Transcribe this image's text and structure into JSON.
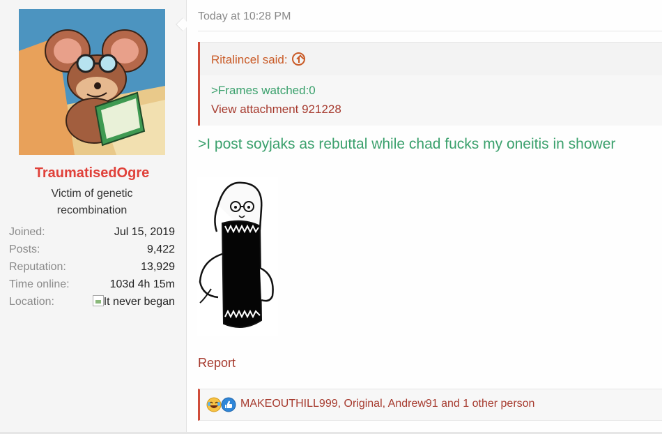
{
  "user": {
    "username": "TraumatisedOgre",
    "title": "Victim of genetic recombination",
    "avatar_icon": "cartoon-mouse-reading-avatar",
    "stats": [
      {
        "label": "Joined:",
        "value": "Jul 15, 2019"
      },
      {
        "label": "Posts:",
        "value": "9,422"
      },
      {
        "label": "Reputation:",
        "value": "13,929"
      },
      {
        "label": "Time online:",
        "value": "103d 4h 15m"
      },
      {
        "label": "Location:",
        "value": "It never began"
      }
    ]
  },
  "post": {
    "timestamp": "Today at 10:28 PM",
    "quote": {
      "author": "Ritalincel said:",
      "line1": ">Frames watched:0",
      "line2": "View attachment 921228"
    },
    "body": ">I post soyjaks as rebuttal while chad fucks my oneitis in shower",
    "image_icon": "soyjak-drawing",
    "report_label": "Report",
    "reactions_text": "MAKEOUTHILL999, Original, Andrew91 and 1 other person"
  },
  "colors": {
    "username": "#e0413a",
    "link": "#a63a2e",
    "greentext": "#3aa06c",
    "quote_author": "#c95a26",
    "accent_border": "#d04c3a"
  }
}
